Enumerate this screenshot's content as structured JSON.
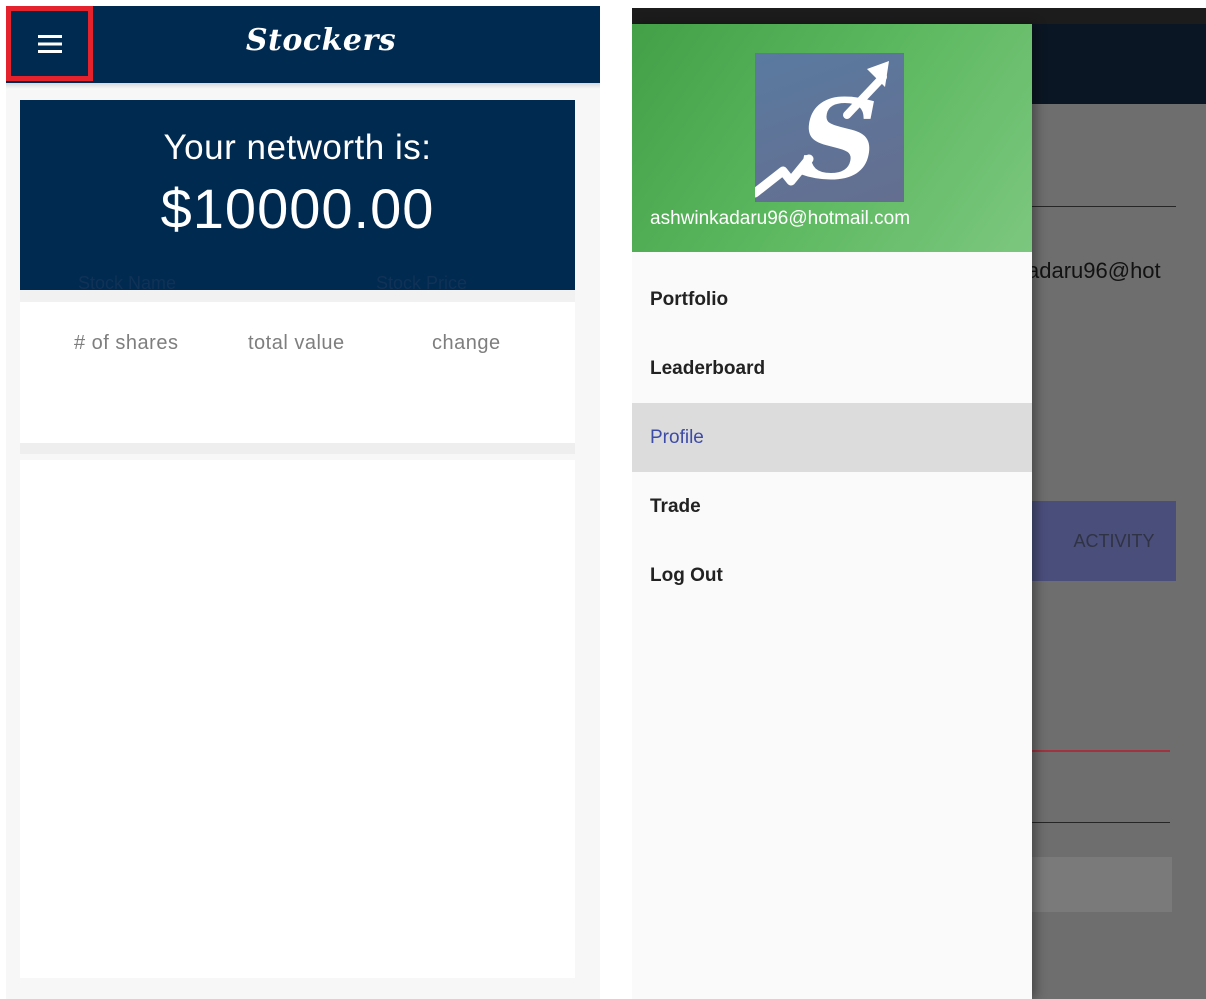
{
  "left": {
    "app_title": "Stockers",
    "networth_label": "Your networth is:",
    "networth_value": "$10000.00",
    "faded_headers": {
      "stock_name": "Stock Name",
      "stock_price": "Stock Price"
    },
    "columns": [
      "# of shares",
      "total value",
      "change"
    ],
    "icons": {
      "menu": "menu-icon"
    },
    "colors": {
      "appbar": "#002a50",
      "highlight": "#e3222d"
    }
  },
  "right": {
    "drawer": {
      "email": "ashwinkadaru96@hotmail.com",
      "items": [
        {
          "label": "Portfolio",
          "active": false
        },
        {
          "label": "Leaderboard",
          "active": false
        },
        {
          "label": "Profile",
          "active": true
        },
        {
          "label": "Trade",
          "active": false
        },
        {
          "label": "Log Out",
          "active": false
        }
      ],
      "icons": {
        "logo": "stockers-logo-icon"
      },
      "colors": {
        "header": "#4caf50",
        "active_text": "#3d4ba8"
      }
    },
    "background": {
      "email_fragment": "adaru96@hot",
      "activity_label": "ACTIVITY"
    }
  }
}
